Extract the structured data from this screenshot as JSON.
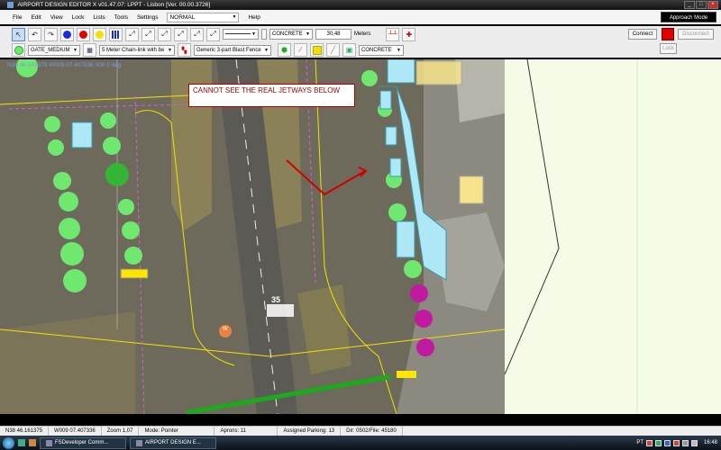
{
  "window": {
    "title": "AIRPORT DESIGN EDITOR X  v01.47.07: LPPT - Lisbon [Ver. 00.00.3726]"
  },
  "menu": [
    "File",
    "Edit",
    "View",
    "Lock",
    "Lists",
    "Tools",
    "Settings"
  ],
  "mode_select": "NORMAL",
  "help_label": "Help",
  "approach_mode_label": "Approach Mode",
  "toolbar1": {
    "surface_select": "CONCRETE",
    "width_value": "30,48",
    "width_unit": "Meters",
    "connect_label": "Connect",
    "disconnect_label": "Disconnect",
    "status_color": "#e00000"
  },
  "toolbar2": {
    "gate_select": "GATE_MEDIUM",
    "fence_select": "5 Meter Chain-link with be",
    "blast_fence_select": "Generic 3-part Blast Fence",
    "surface_select": "CONCRETE",
    "lock_label": "Lock"
  },
  "map": {
    "coord_overlay": "N38 46.161375 W009 07.407336 000 0 deg",
    "runway_number": "35",
    "windsock_label": "W",
    "annotation_text": "CANNOT SEE THE REAL JETWAYS BELOW"
  },
  "status": {
    "lat": "N38 46.161375",
    "lon": "W009 07.407336",
    "zoom": "Zoom 1,07",
    "mode": "Mode: Pointer",
    "aprons": "Aprons: 11",
    "parking": "Assigned Parking: 13",
    "dir_file": "Dir: 0502/File: 45180"
  },
  "taskbar": {
    "items": [
      "FSDeveloper Comm...",
      "AIRPORT DESIGN E..."
    ],
    "lang": "PT",
    "clock": "16:48"
  },
  "colors": {
    "accent_red": "#e00000",
    "parking_green": "#6ee86e",
    "parking_magenta": "#c01aa0",
    "jetway_blue": "#aee8f7",
    "map_bg": "#6d6a5c",
    "scenery_bg": "#f4fbe6"
  }
}
